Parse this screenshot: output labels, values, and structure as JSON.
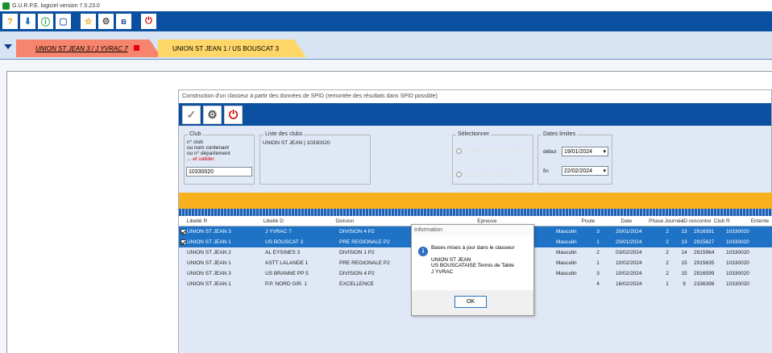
{
  "window": {
    "title": "G.U.R.P.E. logiciel version 7.5.23.0"
  },
  "tabs": [
    {
      "label": "UNION ST JEAN 3 / J YVRAC 7",
      "color": "#f7846c"
    },
    {
      "label": "UNION ST JEAN 1 / US BOUSCAT 3",
      "color": "#ffd768"
    }
  ],
  "dialog": {
    "title": "Construction d'un classeur à partir des données de SPID (remontée des résultats dans SPID possible)",
    "club_group": {
      "title": "Club",
      "line1": "n° club",
      "line2": "ou nom contenant",
      "line3": "ou n° département",
      "line4": "... et valider.",
      "value": "10330020"
    },
    "clubs_group": {
      "title": "Liste des clubs",
      "item": "UNION ST JEAN | 10330020"
    },
    "select_group": {
      "title": "Sélectionner",
      "opt1": "les rencontres à domicile",
      "opt2": "toutes les rencontres"
    },
    "dates_group": {
      "title": "Dates limites",
      "start_label": "début",
      "start": "19/01/2024",
      "end_label": "fin",
      "end": "22/02/2024"
    }
  },
  "table": {
    "headers": {
      "lr": "Libellé R",
      "ld": "Libellé D",
      "div": "Division",
      "ep": "Epreuve",
      "poule": "Poule",
      "date": "Date",
      "phase": "Phase",
      "jour": "Journée",
      "id": "ID rencontre",
      "club": "Club R",
      "ent": "Entente"
    },
    "rows": [
      {
        "checked": true,
        "lr": "UNION ST JEAN 3",
        "ld": "J YVRAC 7",
        "div": "DIVISION 4 P2",
        "ep": "",
        "sex": "Masculin",
        "poule": "3",
        "date": "20/01/2024",
        "phase": "2",
        "jour": "13",
        "id": "2916591",
        "club": "10330020"
      },
      {
        "checked": true,
        "lr": "UNION ST JEAN 1",
        "ld": "US BOUSCAT 3",
        "div": "PRE REGIONALE P2",
        "ep": "",
        "sex": "Masculin",
        "poule": "1",
        "date": "20/01/2024",
        "phase": "2",
        "jour": "13",
        "id": "2915627",
        "club": "10330020"
      },
      {
        "checked": false,
        "lr": "UNION ST JEAN 2",
        "ld": "AL EYSINES 3",
        "div": "DIVISION 1 P2",
        "ep": "",
        "sex": "Masculin",
        "poule": "2",
        "date": "03/02/2024",
        "phase": "2",
        "jour": "14",
        "id": "2915964",
        "club": "10330020"
      },
      {
        "checked": false,
        "lr": "UNION ST JEAN 1",
        "ld": "ASTT LALANDE 1",
        "div": "PRE REGIONALE P2",
        "ep": "",
        "sex": "Masculin",
        "poule": "1",
        "date": "10/02/2024",
        "phase": "2",
        "jour": "15",
        "id": "2915635",
        "club": "10330020"
      },
      {
        "checked": false,
        "lr": "UNION ST JEAN 3",
        "ld": "US BRANNE PP 5",
        "div": "DIVISION 4 P2",
        "ep": "",
        "sex": "Masculin",
        "poule": "3",
        "date": "10/02/2024",
        "phase": "2",
        "jour": "15",
        "id": "2916599",
        "club": "10330020"
      },
      {
        "checked": false,
        "lr": "UNION ST JEAN 1",
        "ld": "P.P. NORD GIR. 1",
        "div": "EXCELLENCE",
        "ep": "",
        "sex": "",
        "poule": "4",
        "date": "16/02/2024",
        "phase": "1",
        "jour": "9",
        "id": "2336398",
        "club": "10330020"
      }
    ]
  },
  "message": {
    "title": "Information",
    "line1": "Bases mises à jour dans le classeur",
    "line2": "UNION ST JEAN",
    "line3": "US BOUSCATAISE Tennis de Table",
    "line4": "J YVRAC",
    "ok": "OK"
  }
}
